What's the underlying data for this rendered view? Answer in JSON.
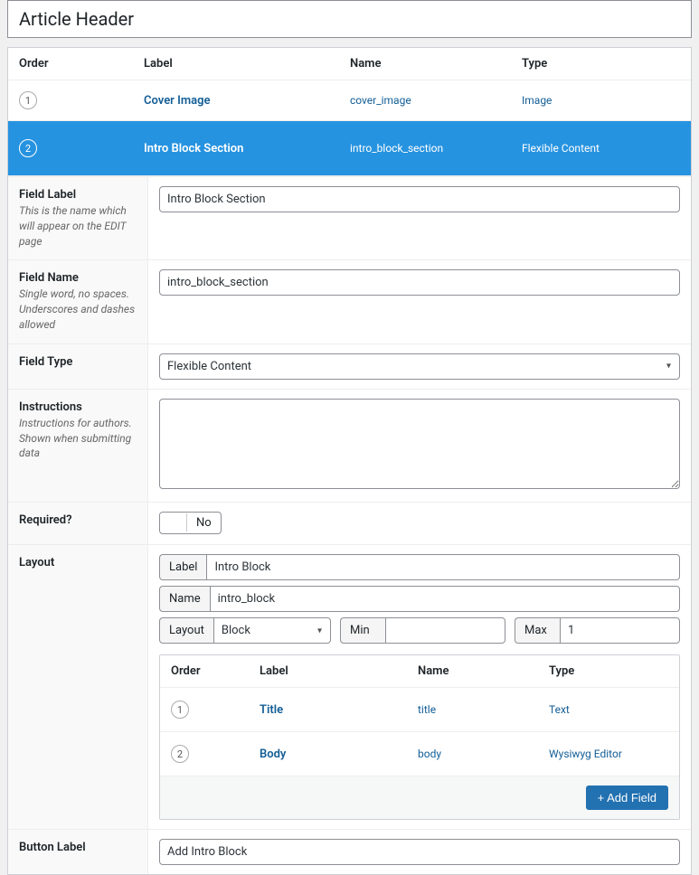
{
  "title": "Article Header",
  "headers": {
    "order": "Order",
    "label": "Label",
    "name": "Name",
    "type": "Type"
  },
  "fields": [
    {
      "order": "1",
      "label": "Cover Image",
      "name": "cover_image",
      "type": "Image",
      "selected": false
    },
    {
      "order": "2",
      "label": "Intro Block Section",
      "name": "intro_block_section",
      "type": "Flexible Content",
      "selected": true
    }
  ],
  "settings": {
    "field_label": {
      "title": "Field Label",
      "hint": "This is the name which will appear on the EDIT page",
      "value": "Intro Block Section"
    },
    "field_name": {
      "title": "Field Name",
      "hint": "Single word, no spaces. Underscores and dashes allowed",
      "value": "intro_block_section"
    },
    "field_type": {
      "title": "Field Type",
      "value": "Flexible Content"
    },
    "instructions": {
      "title": "Instructions",
      "hint": "Instructions for authors. Shown when submitting data",
      "value": ""
    },
    "required": {
      "title": "Required?",
      "value": "No"
    },
    "layout": {
      "title": "Layout",
      "label_text": "Label",
      "label_value": "Intro Block",
      "name_text": "Name",
      "name_value": "intro_block",
      "layout_text": "Layout",
      "layout_value": "Block",
      "min_text": "Min",
      "min_value": "",
      "max_text": "Max",
      "max_value": "1",
      "subfields": [
        {
          "order": "1",
          "label": "Title",
          "name": "title",
          "type": "Text"
        },
        {
          "order": "2",
          "label": "Body",
          "name": "body",
          "type": "Wysiwyg Editor"
        }
      ],
      "add_field": "+ Add Field"
    },
    "button_label": {
      "title": "Button Label",
      "value": "Add Intro Block"
    }
  }
}
